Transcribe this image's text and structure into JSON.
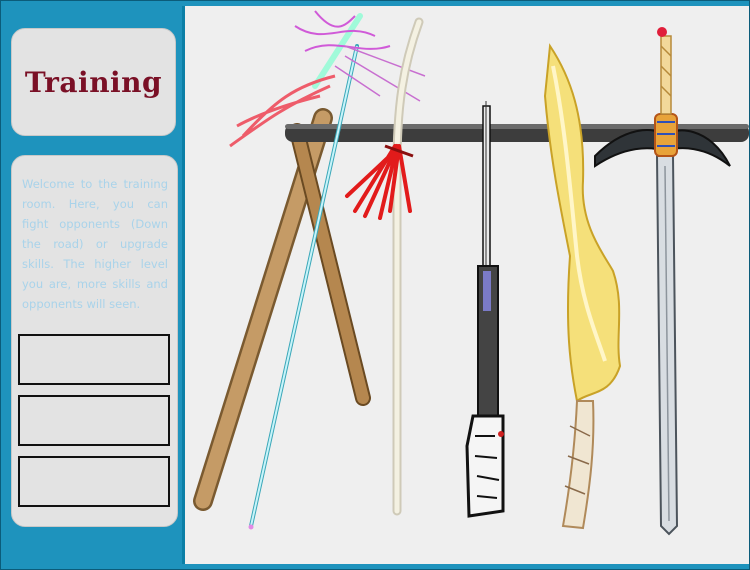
{
  "title": "Training",
  "intro_text": "Welcome to the training room. Here, you can fight opponents (Down the road) or upgrade skills. The higher level you are, more skills and opponents will seen.",
  "option_slots": [
    "",
    "",
    ""
  ],
  "colors": {
    "frame": "#1e93bd",
    "card": "#e3e3e3",
    "title": "#7a1026",
    "intro_text": "#a9d3ea",
    "scene_bg": "#efefef"
  },
  "weapons": [
    "spear-with-ribbons",
    "wooden-staff",
    "tasseled-staff",
    "rifle",
    "golden-blade",
    "longsword"
  ]
}
